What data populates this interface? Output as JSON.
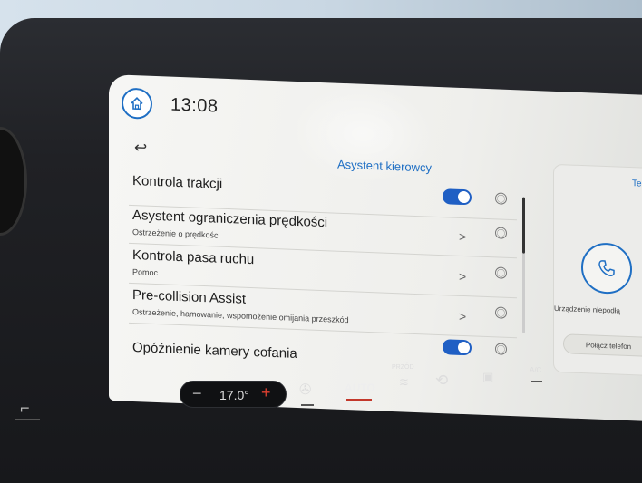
{
  "header": {
    "time": "13:08",
    "panel_title": "Asystent kierowcy"
  },
  "settings": [
    {
      "label": "Kontrola trakcji",
      "sub": "",
      "control": "toggle",
      "enabled": true
    },
    {
      "label": "Asystent ograniczenia prędkości",
      "sub": "Ostrzeżenie o prędkości",
      "control": "chevron"
    },
    {
      "label": "Kontrola pasa ruchu",
      "sub": "Pomoc",
      "control": "chevron"
    },
    {
      "label": "Pre-collision Assist",
      "sub": "Ostrzeżenie, hamowanie, wspomożenie omijania przeszkód",
      "control": "chevron"
    },
    {
      "label": "Opóźnienie kamery cofania",
      "sub": "",
      "control": "toggle",
      "enabled": true
    }
  ],
  "info_glyph": "ⓘ",
  "chevron_glyph": ">",
  "side_card": {
    "title": "Telefo",
    "status": "Urządzenie niepodłą",
    "connect_button": "Połącz telefon"
  },
  "climate": {
    "temperature": "17.0°",
    "minus": "−",
    "plus": "+",
    "auto": "AUTO",
    "front": "PRZÓD",
    "ac": "A/C"
  },
  "colors": {
    "accent": "#1f6fc4",
    "toggle_on": "#1f5fc4",
    "temp_plus": "#e04030"
  },
  "icons": [
    "home-icon",
    "back-arrow-icon",
    "info-icon",
    "chevron-right-icon",
    "phone-icon",
    "seat-icon",
    "fan-icon",
    "front-defrost-icon",
    "recirculation-icon",
    "rear-defrost-icon"
  ]
}
